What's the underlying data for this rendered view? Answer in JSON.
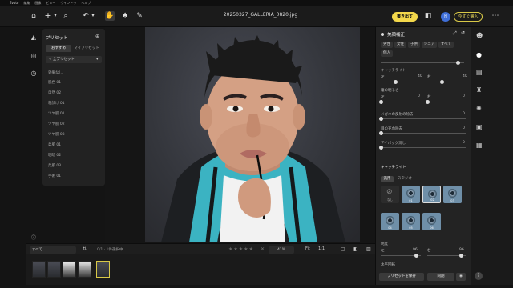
{
  "menu": {
    "app": "Evoto",
    "items": [
      "編集",
      "画像",
      "ビュー",
      "ウインドウ",
      "ヘルプ"
    ]
  },
  "toolbar": {
    "filename": "20250327_GALLERIA_0820.jpg",
    "export_label": "書き出す",
    "upgrade_label": "今すぐ購入",
    "avatar_letter": "H"
  },
  "presets": {
    "title": "プリセット",
    "tabs": [
      "おすすめ",
      "マイプリセット"
    ],
    "dropdown": "全プリセット",
    "items": [
      "効果なし",
      "肌色 01",
      "自然 02",
      "粗顔け 01",
      "ツヤ肌 01",
      "ツヤ肌 02",
      "ツヤ肌 03",
      "柔肌 01",
      "明暗 02",
      "柔肌 03",
      "手術 01"
    ]
  },
  "right_panel": {
    "title": "美顔補正",
    "gender_chips": [
      "男性",
      "女性",
      "子供",
      "シニア",
      "すべて"
    ],
    "chip_extra": "個人",
    "catchlight_title": "キャッチライト",
    "left_label": "左",
    "right_label": "右",
    "left_value": "40",
    "right_value": "40",
    "reflect_label": "瞳の明るさ",
    "reflect_left": "0",
    "reflect_right": "0",
    "glare_label": "メガネの反射の除去",
    "glare_value": "0",
    "redeye_label": "目の充血除去",
    "redeye_value": "0",
    "eyebag_label": "アイバッグ消し",
    "eyebag_value": "0",
    "catchlight2_title": "キャッチライト",
    "mode_chips": [
      "汎用",
      "スタジオ"
    ],
    "tiles": [
      "なし",
      "01",
      "02",
      "03",
      "04",
      "05",
      "06"
    ],
    "size_label": "明度",
    "size_left": "96",
    "size_right": "96",
    "level_label": "水平回転",
    "save_preset": "プリセットを保存",
    "sync_label": "同期"
  },
  "bottombar": {
    "filter": "すべて",
    "count": "0/1 · 1件選択中",
    "zoom": "41%",
    "fit": "Fit",
    "one": "1:1"
  },
  "colors": {
    "accent_yellow": "#f3d84b",
    "avatar_blue": "#3f6fd8",
    "selected_thumb": "#d8c847"
  },
  "icons": {
    "left_rail": [
      "presets-icon",
      "retouch-icon",
      "history-icon"
    ],
    "far_right": [
      "face-icon",
      "body-icon",
      "background-icon",
      "clothes-icon",
      "color-icon",
      "camera-icon",
      "adjust-icon"
    ]
  }
}
